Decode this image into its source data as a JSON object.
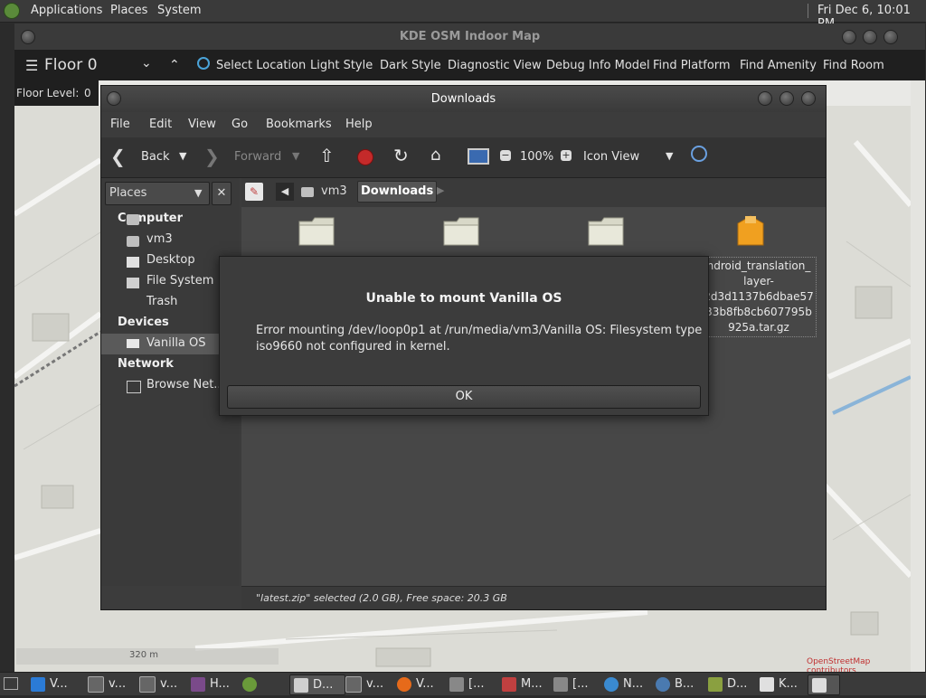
{
  "top_panel": {
    "menus": [
      "Applications",
      "Places",
      "System"
    ],
    "clock": "Fri Dec  6, 10:01 PM"
  },
  "kde_window": {
    "title": "KDE OSM Indoor Map",
    "floor": "Floor 0",
    "toolbar": [
      "Select Location",
      "Light Style",
      "Dark Style",
      "Diagnostic View",
      "Debug Info Model",
      "Find Platform",
      "Find Amenity",
      "Find Room"
    ],
    "floor_level_label": "Floor Level:",
    "floor_level_value": "0",
    "scale": "320 m",
    "attribution": "OpenStreetMap contributors"
  },
  "file_manager": {
    "title": "Downloads",
    "menu": [
      "File",
      "Edit",
      "View",
      "Go",
      "Bookmarks",
      "Help"
    ],
    "toolbar": {
      "back": "Back",
      "forward": "Forward",
      "zoom": "100%",
      "view_mode": "Icon View"
    },
    "sidebar": {
      "selector": "Places",
      "sections": [
        {
          "heading": "Computer",
          "items": [
            "vm3",
            "Desktop",
            "File System",
            "Trash"
          ]
        },
        {
          "heading": "Devices",
          "items": [
            "Vanilla OS"
          ]
        },
        {
          "heading": "Network",
          "items": [
            "Browse Net..."
          ]
        }
      ]
    },
    "path": [
      "vm3",
      "Downloads"
    ],
    "files": [
      {
        "name": ""
      },
      {
        "name": ""
      },
      {
        "name": ""
      },
      {
        "name": "android_translation_layer-2d3d1137b6dbae5733b8fb8cb607795b925a.tar.gz"
      }
    ],
    "file_label_lines": [
      "ndroid_translation_",
      "layer-",
      "2d3d1137b6dbae57",
      "33b8fb8cb607795b",
      "925a.tar.gz"
    ],
    "status": "\"latest.zip\" selected (2.0 GB), Free space: 20.3 GB"
  },
  "dialog": {
    "title": "Unable to mount Vanilla OS",
    "message_line1": "Error mounting /dev/loop0p1 at /run/media/vm3/Vanilla OS: Filesystem type",
    "message_line2": "iso9660 not configured in kernel.",
    "ok": "OK"
  },
  "taskbar": {
    "items": [
      {
        "label": "V...",
        "icon": "vscode-icon",
        "color": "#2b7bd6"
      },
      {
        "label": "v...",
        "icon": "terminal-icon",
        "color": "#666"
      },
      {
        "label": "v...",
        "icon": "terminal-icon",
        "color": "#666"
      },
      {
        "label": "H...",
        "icon": "app-icon",
        "color": "#7a4a8a"
      },
      {
        "label": "",
        "icon": "android-icon",
        "color": "#6a9a3a"
      },
      {
        "label": "D...",
        "icon": "folder-icon",
        "color": "#cfcfcf"
      },
      {
        "label": "v...",
        "icon": "terminal-icon",
        "color": "#666"
      },
      {
        "label": "V...",
        "icon": "firefox-icon",
        "color": "#e66a1a"
      },
      {
        "label": "[...",
        "icon": "camera-icon",
        "color": "#888"
      },
      {
        "label": "M...",
        "icon": "map-icon",
        "color": "#c04040"
      },
      {
        "label": "[...",
        "icon": "screenshot-icon",
        "color": "#888"
      },
      {
        "label": "N...",
        "icon": "globe-icon",
        "color": "#3a8ad0"
      },
      {
        "label": "B...",
        "icon": "gear-icon",
        "color": "#4a7ab0"
      },
      {
        "label": "D...",
        "icon": "dconf-icon",
        "color": "#8aa040"
      },
      {
        "label": "K...",
        "icon": "home-icon",
        "color": "#e0e0e0"
      },
      {
        "label": "",
        "icon": "window-icon",
        "color": "#ddd"
      }
    ]
  }
}
